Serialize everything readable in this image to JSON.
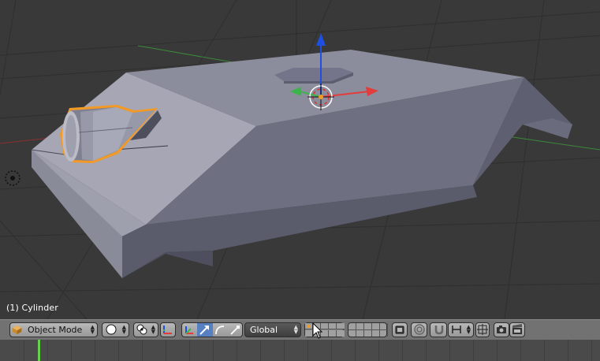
{
  "viewport": {
    "object_label": "(1) Cylinder",
    "selected_object": "Cylinder"
  },
  "header": {
    "editor_type_icon": "3d-view-icon",
    "mode": "Object Mode",
    "viewport_shading_icon": "solid-sphere-icon",
    "pivot_icon": "pivot-point-icon",
    "orientation": "Global",
    "manipulator_icons": [
      "translate-icon",
      "rotate-icon",
      "scale-icon"
    ],
    "snap_icon": "magnet-icon"
  },
  "colors": {
    "background": "#393939",
    "header": "#727272",
    "selection_outline": "#f39a26",
    "x_axis": "#e23c3c",
    "y_axis": "#3cb44a",
    "z_axis": "#1e4fe0",
    "current_frame": "#62d34a"
  }
}
